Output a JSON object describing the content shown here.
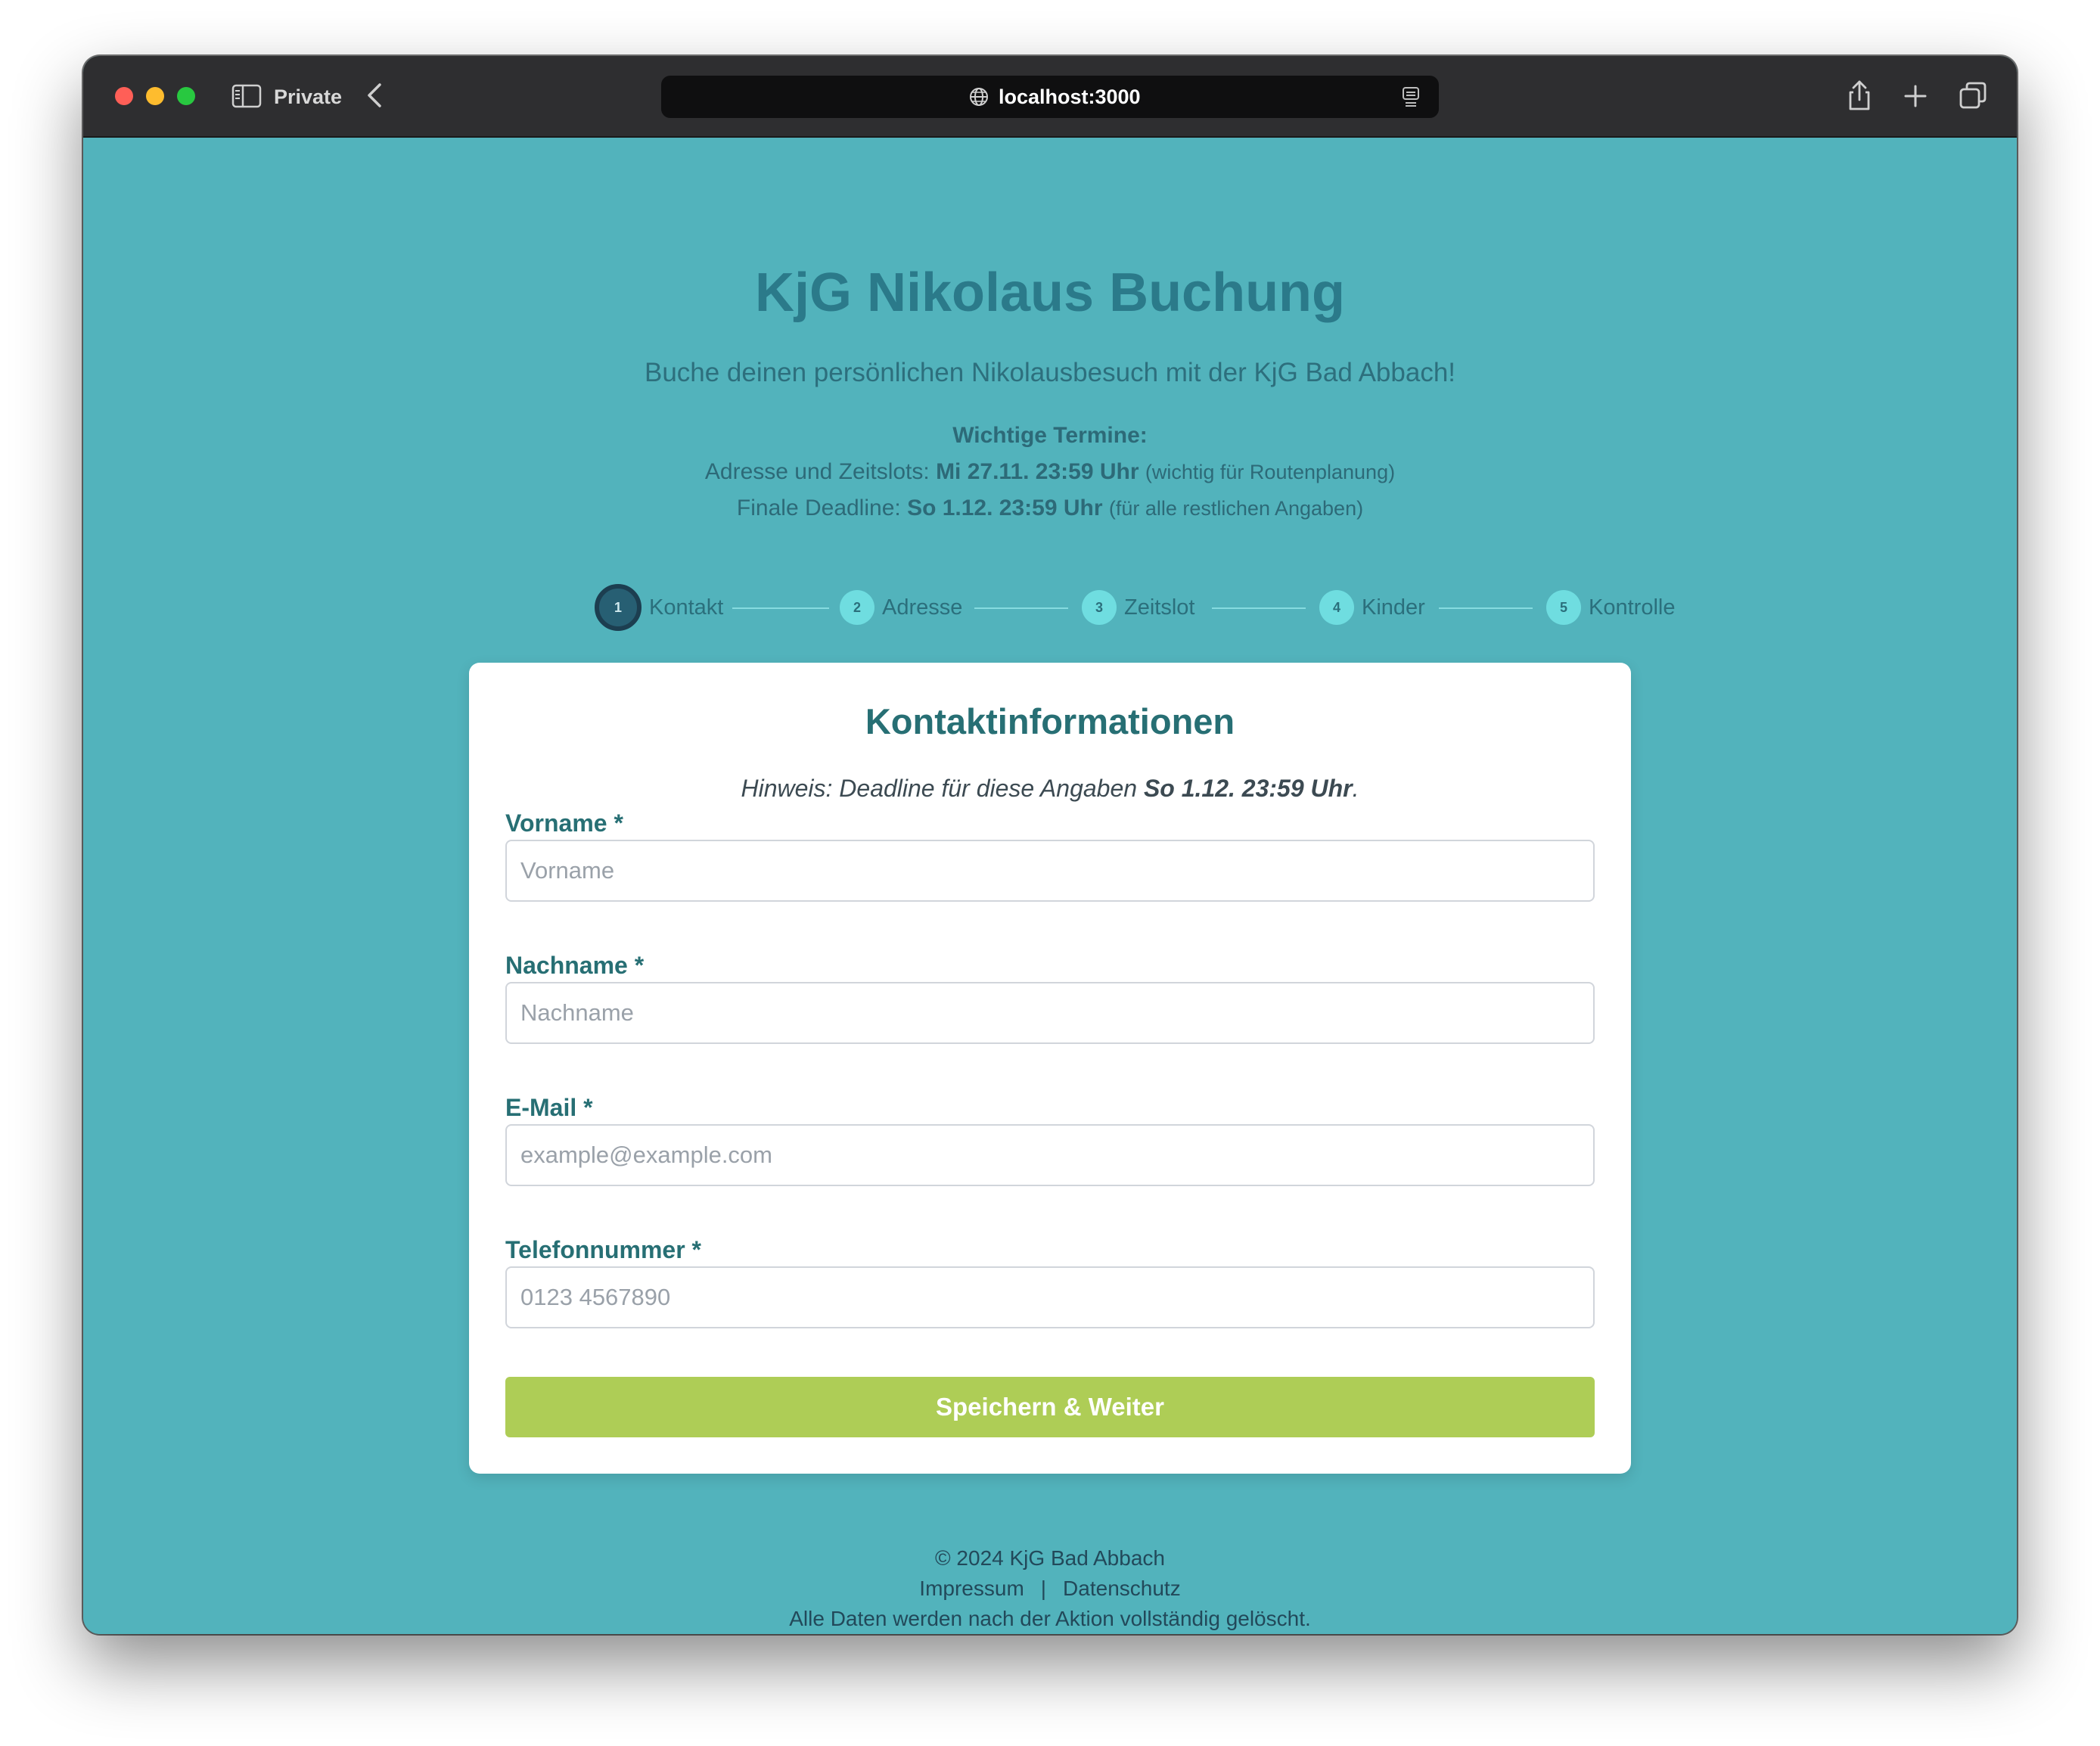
{
  "browser": {
    "private_label": "Private",
    "url": "localhost:3000"
  },
  "header": {
    "title": "KjG Nikolaus Buchung",
    "subtitle": "Buche deinen persönlichen Nikolausbesuch mit der KjG Bad Abbach!",
    "dates_heading": "Wichtige Termine:",
    "date1_prefix": "Adresse und Zeitslots:",
    "date1_value": "Mi 27.11. 23:59 Uhr",
    "date1_note": "(wichtig für Routenplanung)",
    "date2_prefix": "Finale Deadline:",
    "date2_value": "So 1.12. 23:59 Uhr",
    "date2_note": "(für alle restlichen Angaben)"
  },
  "stepper": {
    "steps": [
      {
        "number": "1",
        "label": "Kontakt"
      },
      {
        "number": "2",
        "label": "Adresse"
      },
      {
        "number": "3",
        "label": "Zeitslot"
      },
      {
        "number": "4",
        "label": "Kinder"
      },
      {
        "number": "5",
        "label": "Kontrolle"
      }
    ],
    "active_step": 1
  },
  "form": {
    "title": "Kontaktinformationen",
    "hint_prefix": "Hinweis: Deadline für diese Angaben",
    "hint_deadline": "So 1.12. 23:59 Uhr",
    "hint_suffix": ".",
    "fields": [
      {
        "label": "Vorname *",
        "placeholder": "Vorname",
        "value": ""
      },
      {
        "label": "Nachname *",
        "placeholder": "Nachname",
        "value": ""
      },
      {
        "label": "E-Mail *",
        "placeholder": "example@example.com",
        "value": ""
      },
      {
        "label": "Telefonnummer *",
        "placeholder": "0123 4567890",
        "value": ""
      }
    ],
    "submit_label": "Speichern & Weiter"
  },
  "footer": {
    "copyright": "© 2024 KjG Bad Abbach",
    "impressum": "Impressum",
    "separator": "|",
    "datenschutz": "Datenschutz",
    "notice": "Alle Daten werden nach der Aktion vollständig gelöscht."
  },
  "colors": {
    "page_background": "#52b3bc",
    "title": "#2b7a8a",
    "accent_button": "#aecd56",
    "active_step": "#275f73",
    "inactive_step": "#6fdde0"
  }
}
